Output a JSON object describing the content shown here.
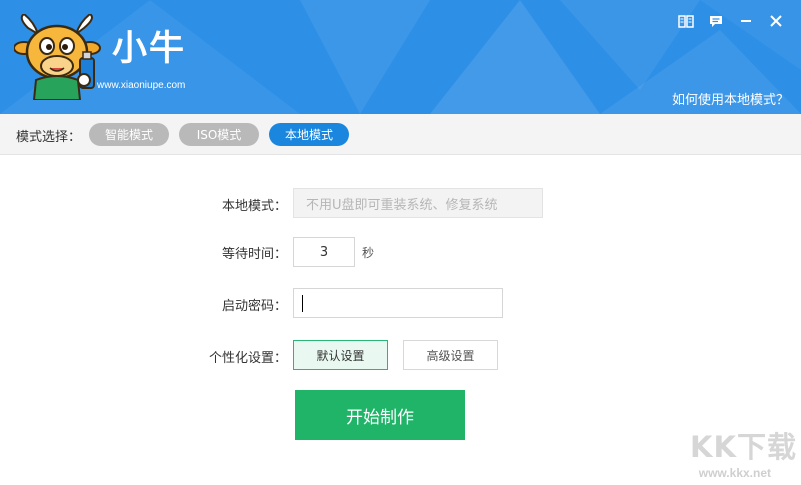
{
  "header": {
    "brand": "小牛",
    "url": "www.xiaoniupe.com",
    "help_link": "如何使用本地模式？",
    "background_color": "#2d8fe6",
    "controls": [
      {
        "name": "book-icon"
      },
      {
        "name": "chat-icon"
      },
      {
        "name": "minimize-icon"
      },
      {
        "name": "close-icon"
      }
    ]
  },
  "modebar": {
    "label": "模式选择：",
    "modes": [
      {
        "label": "智能模式",
        "active": false
      },
      {
        "label": "ISO模式",
        "active": false
      },
      {
        "label": "本地模式",
        "active": true
      }
    ],
    "active_color": "#1a86de"
  },
  "form": {
    "local_mode": {
      "label": "本地模式：",
      "placeholder": "不用U盘即可重装系统、修复系统"
    },
    "wait_time": {
      "label": "等待时间：",
      "value": "3",
      "unit": "秒"
    },
    "boot_password": {
      "label": "启动密码：",
      "value": ""
    },
    "personalize": {
      "label": "个性化设置：",
      "options": [
        "默认设置",
        "高级设置"
      ],
      "selected": "默认设置"
    }
  },
  "start_button": {
    "label": "开始制作",
    "color": "#1fb468"
  },
  "watermark": {
    "text": "KK下载",
    "url": "www.kkx.net"
  }
}
